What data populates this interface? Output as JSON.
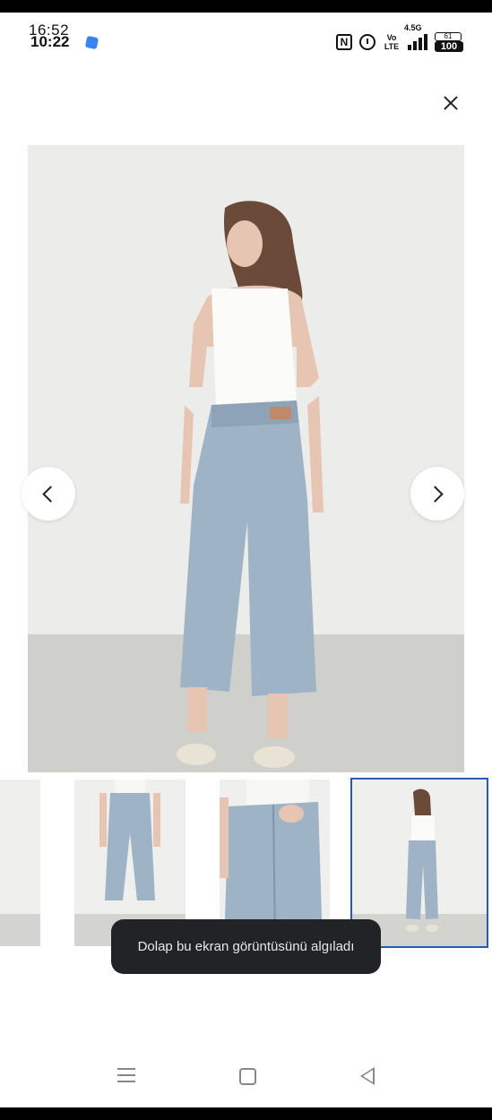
{
  "status_bar": {
    "time_primary": "16:52",
    "time_secondary": "10:22",
    "nfc_label": "N",
    "volte_label": "Vo LTE",
    "network_label": "4.5G",
    "battery_top": "61",
    "battery_level": "100",
    "icons": [
      "app-notification-icon",
      "nfc-icon",
      "alarm-icon",
      "volte-icon",
      "signal-icon",
      "battery-icon"
    ]
  },
  "gallery": {
    "close_icon": "close-icon",
    "prev_icon": "chevron-left-icon",
    "next_icon": "chevron-right-icon",
    "active_thumbnail": 4,
    "thumbnails_count": 4
  },
  "toast": {
    "message": "Dolap bu ekran görüntüsünü algıladı"
  },
  "system_nav": {
    "icons": [
      "menu-icon",
      "home-icon",
      "back-icon"
    ]
  },
  "colors": {
    "accent_selected": "#2a59b8",
    "toast_bg": "#222326"
  }
}
